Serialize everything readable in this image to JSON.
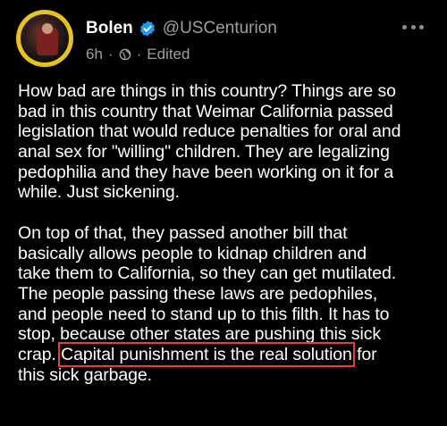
{
  "author": {
    "display_name": "Bolen",
    "handle": "@USCenturion",
    "verified_icon": "verified-badge-icon",
    "verified_color": "#1d9bf0"
  },
  "meta": {
    "time": "6h",
    "dot1": "·",
    "visibility_icon": "globe-icon",
    "dot2": "·",
    "edited": "Edited"
  },
  "post": {
    "lines": [
      "How bad are things in this country? Things are so",
      "bad in this country that Weimar California passed",
      "legislation that would reduce penalties for oral and",
      "anal sex for \"willing\" children. They are legalizing",
      "pedophilia and they have been working on it for a",
      "while. Just sickening.",
      "On top of that, they passed another bill that",
      "basically allows people to kidnap children and",
      "take them to California, so they can get mutilated.",
      "The people passing these laws are pedophiles,",
      "and people need to stand up to this filth. It has to",
      "stop, because other states are pushing this sick"
    ],
    "line13_before": "crap. ",
    "highlighted": "Capital punishment is the real solution",
    "line13_after": " for",
    "last_line": "this sick garbage."
  },
  "colors": {
    "background": "#000000",
    "text": "#ffffff",
    "muted": "#9aa0a8",
    "highlight_box": "#e0413a",
    "avatar_ring": "#e7c31c"
  }
}
